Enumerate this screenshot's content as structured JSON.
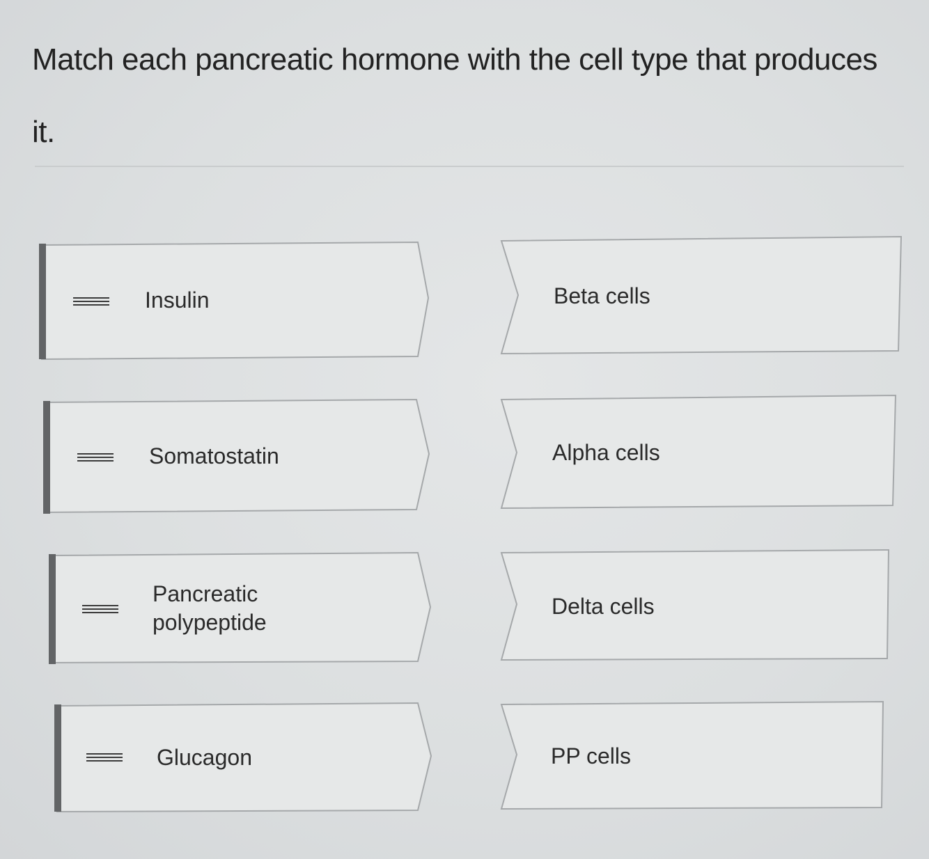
{
  "question": {
    "text": "Match each pancreatic hormone with the cell type that produces it."
  },
  "prompts": [
    {
      "label": "Insulin"
    },
    {
      "label": "Somatostatin"
    },
    {
      "label": "Pancreatic polypeptide",
      "line1": "Pancreatic",
      "line2": "polypeptide"
    },
    {
      "label": "Glucagon"
    }
  ],
  "answers": [
    {
      "label": "Beta cells"
    },
    {
      "label": "Alpha cells"
    },
    {
      "label": "Delta cells"
    },
    {
      "label": "PP cells"
    }
  ],
  "icons": {
    "handle": "drag-handle-icon"
  },
  "colors": {
    "accent_bar": "#626466",
    "card_fill": "#e6e8e8",
    "card_border": "#a5a8aa"
  }
}
